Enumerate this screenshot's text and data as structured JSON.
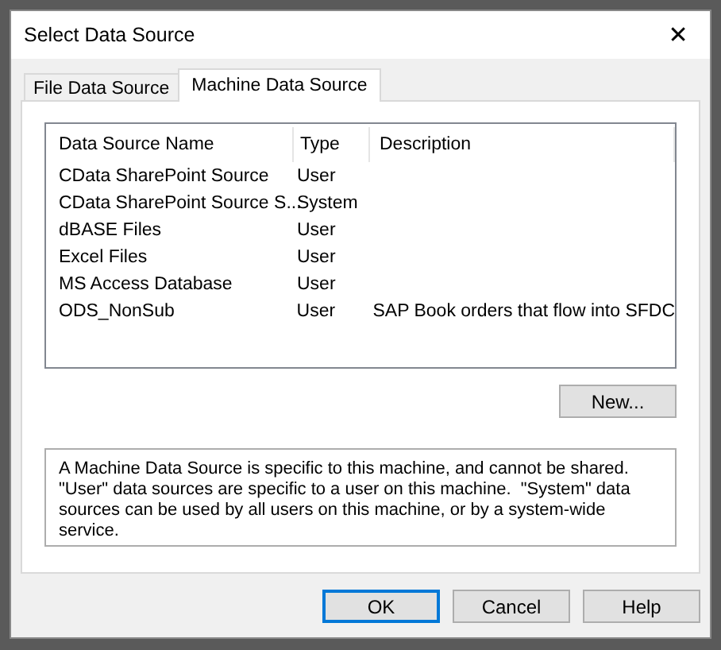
{
  "window": {
    "title": "Select Data Source",
    "close": "✕"
  },
  "tabs": [
    {
      "label": "File Data Source",
      "selected": false
    },
    {
      "label": "Machine Data Source",
      "selected": true
    }
  ],
  "table": {
    "columns": [
      "Data Source Name",
      "Type",
      "Description"
    ],
    "rows": [
      {
        "cells": [
          "CData SharePoint Source",
          "User",
          ""
        ],
        "selected": false
      },
      {
        "cells": [
          "CData SharePoint Source S...",
          "System",
          ""
        ],
        "selected": false
      },
      {
        "cells": [
          "dBASE Files",
          "User",
          ""
        ],
        "selected": false
      },
      {
        "cells": [
          "Excel Files",
          "User",
          ""
        ],
        "selected": false
      },
      {
        "cells": [
          "MS Access Database",
          "User",
          ""
        ],
        "selected": false
      },
      {
        "cells": [
          "ODS_NonSub",
          "User",
          "SAP Book orders that flow into SFDC"
        ],
        "selected": false
      }
    ]
  },
  "new_button": "New...",
  "info_text": "A Machine Data Source is specific to this machine, and cannot be shared.  \"User\" data sources are specific to a user on this machine.  \"System\" data sources can be used by all users on this machine, or by a system-wide service.",
  "buttons": [
    {
      "label": "OK",
      "default": true
    },
    {
      "label": "Cancel",
      "default": false
    },
    {
      "label": "Help",
      "default": false
    }
  ]
}
